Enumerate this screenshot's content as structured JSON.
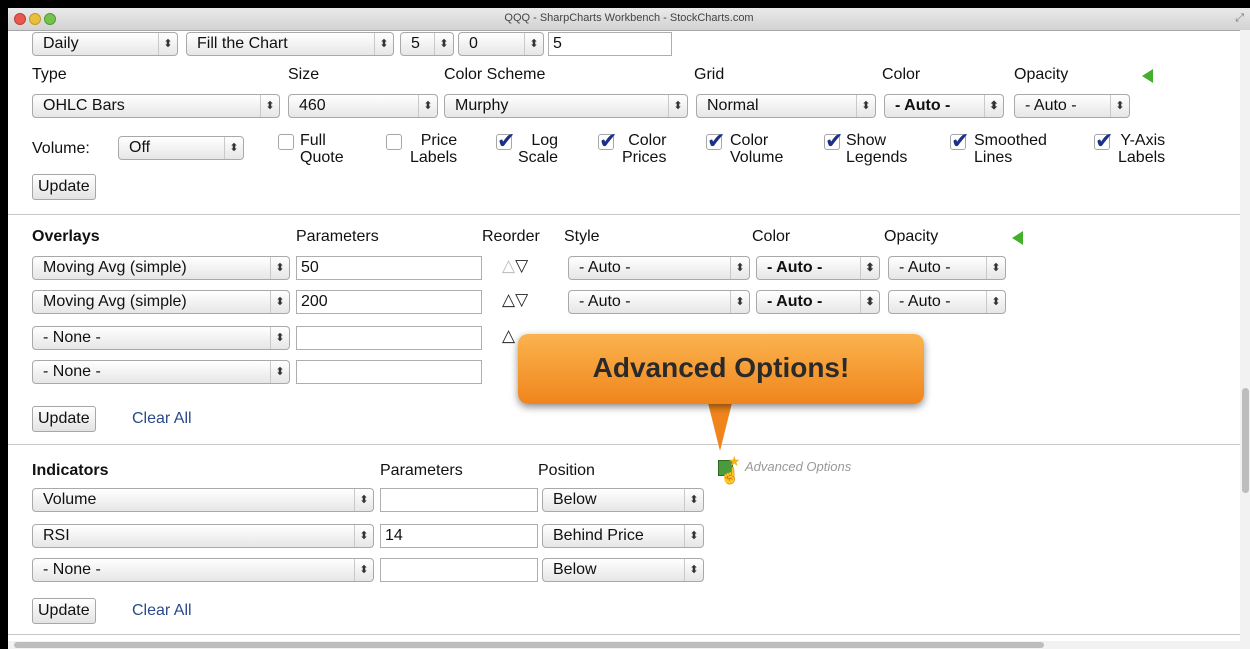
{
  "window": {
    "title": "QQQ - SharpCharts Workbench - StockCharts.com",
    "resize_glyph": "⤢"
  },
  "chart_attributes": {
    "period": "Daily",
    "size_mode": "Fill the Chart",
    "small_select_1": "5",
    "small_select_2": "0",
    "extra_input_value": "5",
    "labels": {
      "type": "Type",
      "size": "Size",
      "color_scheme": "Color Scheme",
      "grid": "Grid",
      "color": "Color",
      "opacity": "Opacity"
    },
    "type_value": "OHLC Bars",
    "size_value": "460",
    "color_scheme_value": "Murphy",
    "grid_value": "Normal",
    "color_value": "- Auto -",
    "opacity_value": "- Auto -",
    "volume_label": "Volume:",
    "volume_value": "Off",
    "checkboxes": [
      {
        "line1": "Full",
        "line2": "Quote",
        "checked": false
      },
      {
        "line1": "Price",
        "line2": "Labels",
        "checked": false
      },
      {
        "line1": "Log",
        "line2": "Scale",
        "checked": true
      },
      {
        "line1": "Color",
        "line2": "Prices",
        "checked": true
      },
      {
        "line1": "Color",
        "line2": "Volume",
        "checked": true
      },
      {
        "line1": "Show",
        "line2": "Legends",
        "checked": true
      },
      {
        "line1": "Smoothed",
        "line2": "Lines",
        "checked": true
      },
      {
        "line1": "Y-Axis",
        "line2": "Labels",
        "checked": true
      }
    ],
    "update_label": "Update",
    "accent_color": "#43b02a"
  },
  "overlays": {
    "header": "Overlays",
    "parameters_header": "Parameters",
    "reorder_header": "Reorder",
    "style_header": "Style",
    "color_header": "Color",
    "opacity_header": "Opacity",
    "rows": [
      {
        "name": "Moving Avg (simple)",
        "params": "50",
        "style": "- Auto -",
        "color": "- Auto -",
        "opacity": "- Auto -"
      },
      {
        "name": "Moving Avg (simple)",
        "params": "200",
        "style": "- Auto -",
        "color": "- Auto -",
        "opacity": "- Auto -"
      },
      {
        "name": "- None -",
        "params": ""
      },
      {
        "name": "- None -",
        "params": ""
      }
    ],
    "update_label": "Update",
    "clear_label": "Clear All"
  },
  "callout": {
    "text": "Advanced Options!",
    "color": "#f59a2e"
  },
  "indicators": {
    "header": "Indicators",
    "parameters_header": "Parameters",
    "position_header": "Position",
    "advanced_link": "Advanced Options",
    "rows": [
      {
        "name": "Volume",
        "params": "",
        "position": "Below"
      },
      {
        "name": "RSI",
        "params": "14",
        "position": "Behind Price"
      },
      {
        "name": "- None -",
        "params": "",
        "position": "Below"
      }
    ],
    "update_label": "Update",
    "clear_label": "Clear All"
  },
  "glyphs": {
    "select_arrows": "⬍",
    "up": "△",
    "down": "▽",
    "star": "★",
    "cursor": "☝"
  }
}
